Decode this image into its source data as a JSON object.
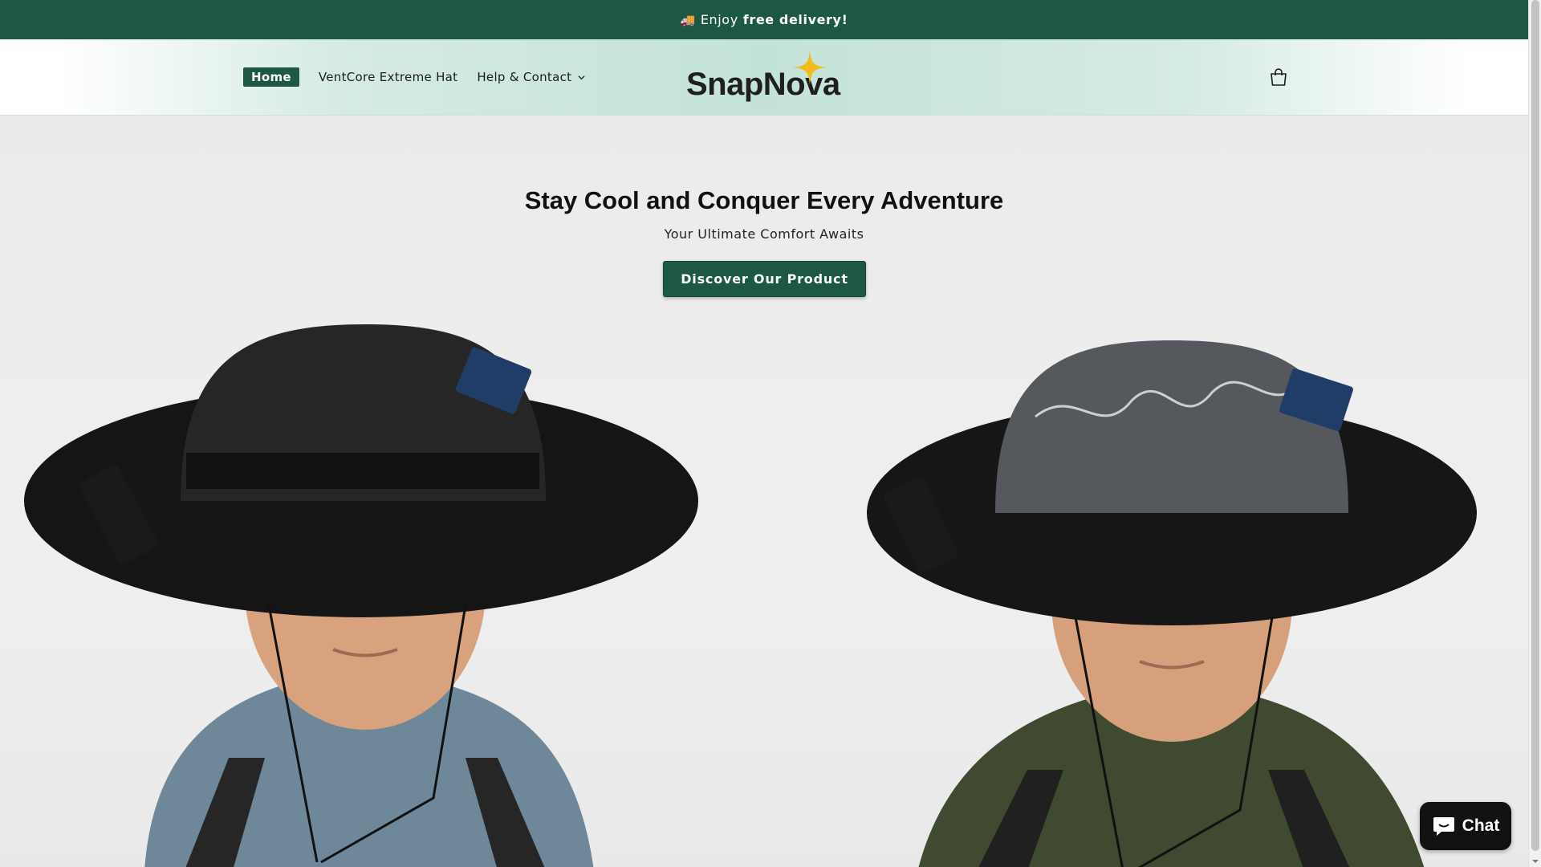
{
  "announcement": {
    "icon": "truck-icon",
    "emoji": "🚚",
    "prefix": "Enjoy",
    "highlight": "free delivery!"
  },
  "nav": {
    "home": "Home",
    "product": "VentCore Extreme Hat",
    "help": "Help & Contact"
  },
  "logo": {
    "text": "SnapNova"
  },
  "hero": {
    "title": "Stay Cool and Conquer Every Adventure",
    "subtitle": "Your Ultimate Comfort Awaits",
    "cta": "Discover Our Product"
  },
  "chat": {
    "label": "Chat"
  },
  "colors": {
    "brand_green": "#1d5845",
    "logo_star": "#f2bb1b"
  }
}
